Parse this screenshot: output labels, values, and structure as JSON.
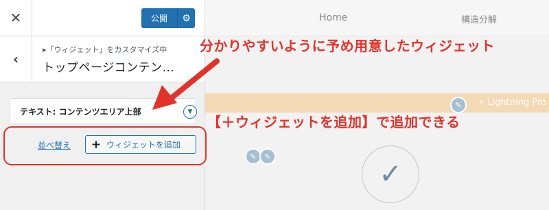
{
  "sidebar": {
    "close_label": "✕",
    "publish_label": "公開",
    "settings_glyph": "⚙",
    "back_label": "‹",
    "breadcrumb": "▸「ウィジェット」をカスタマイズ中",
    "section_title": "トップページコンテン…",
    "widget_title": "テキスト: コンテンツエリア上部",
    "widget_toggle_glyph": "▼",
    "reorder_label": "並べ替え",
    "add_widget_plus": "+",
    "add_widget_label": "ウィジェットを追加"
  },
  "preview": {
    "nav_home": "Home",
    "nav_structure": "構造分解",
    "brand_label": "⚡ Lightning Pro",
    "pencil_glyph": "✎",
    "check_glyph": "✓"
  },
  "annotations": {
    "note1": "分かりやすいように予め用意したウィジェット",
    "note2": "【＋ウィジェットを追加】で追加できる",
    "accent_color": "#e2322a"
  },
  "colors": {
    "primary": "#2271b1",
    "band": "#f3d9b4",
    "annotation": "#e2322a"
  }
}
